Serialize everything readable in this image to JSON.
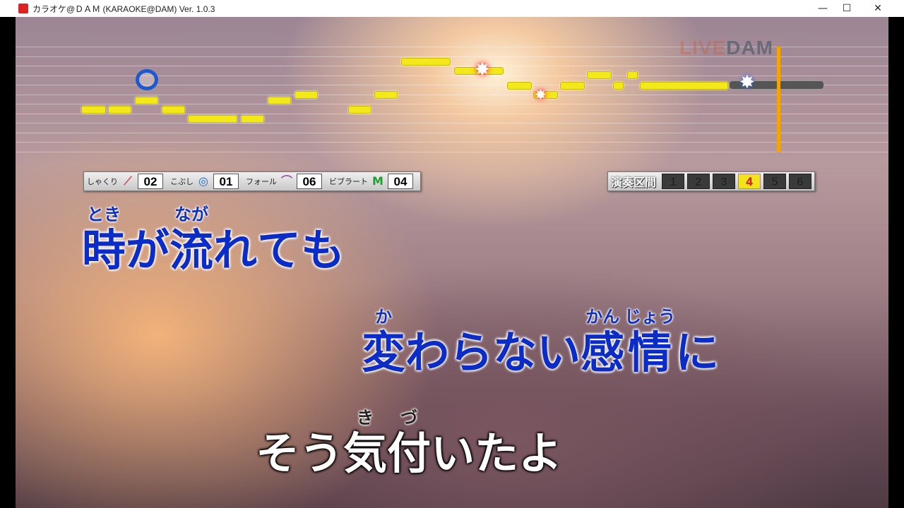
{
  "window": {
    "title": "カラオケ@ＤＡＭ (KARAOKE@DAM) Ver. 1.0.3",
    "minimize": "—",
    "maximize": "☐",
    "close": "✕"
  },
  "logo": {
    "live": "LIVE",
    "dam": "DAM"
  },
  "technique": [
    {
      "label": "しゃくり",
      "icon": "shakuri-icon",
      "glyph": "⟋",
      "color": "#e0404a",
      "count": "02"
    },
    {
      "label": "こぶし",
      "icon": "kobushi-icon",
      "glyph": "◎",
      "color": "#1a6ad0",
      "count": "01"
    },
    {
      "label": "フォール",
      "icon": "fall-icon",
      "glyph": "⌒",
      "color": "#a050b0",
      "count": "06"
    },
    {
      "label": "ビブラート",
      "icon": "vibrato-icon",
      "glyph": "M",
      "color": "#20a030",
      "count": "04"
    }
  ],
  "sections": {
    "label": "演奏区間",
    "items": [
      "1",
      "2",
      "3",
      "4",
      "5",
      "6"
    ],
    "current": "4"
  },
  "lyrics": [
    {
      "style": "blue",
      "chars": [
        [
          "時",
          "とき"
        ],
        [
          "が",
          ""
        ],
        [
          "流",
          "なが"
        ],
        [
          "れ",
          ""
        ],
        [
          "て",
          ""
        ],
        [
          "も",
          ""
        ]
      ]
    },
    {
      "style": "blue",
      "chars": [
        [
          "変",
          "か"
        ],
        [
          "わ",
          ""
        ],
        [
          "ら",
          ""
        ],
        [
          "な",
          ""
        ],
        [
          "い",
          ""
        ],
        [
          "感",
          "かん"
        ],
        [
          "情",
          "じょう"
        ],
        [
          "に",
          ""
        ]
      ]
    },
    {
      "style": "white",
      "chars": [
        [
          "そ",
          ""
        ],
        [
          "う",
          ""
        ],
        [
          "気",
          "き"
        ],
        [
          "付",
          "づ"
        ],
        [
          "い",
          ""
        ],
        [
          "た",
          ""
        ],
        [
          "よ",
          ""
        ]
      ]
    }
  ]
}
